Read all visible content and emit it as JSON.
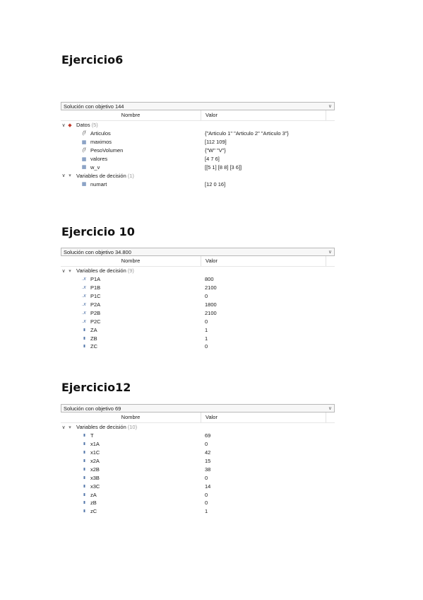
{
  "sections": [
    {
      "heading": "Ejercicio6",
      "dropdown": "Solución con objetivo 144",
      "col_name": "Nombre",
      "col_value": "Valor",
      "rows": [
        {
          "label": "Datos",
          "count": "(5)",
          "icon": "data-group-icon",
          "value": ""
        },
        {
          "label": "Articulos",
          "icon": "string-set-icon",
          "value": "{\"Articulo 1\" \"Articulo 2\" \"Articulo 3\"}"
        },
        {
          "label": "maximos",
          "icon": "array-icon",
          "value": "[112 109]"
        },
        {
          "label": "PesoVolumen",
          "icon": "string-set-icon",
          "value": "{\"W\" \"V\"}"
        },
        {
          "label": "valores",
          "icon": "array-icon",
          "value": "[4 7 6]"
        },
        {
          "label": "w_v",
          "icon": "array-icon",
          "value": "[[5 1]  [8 8]  [3 6]]"
        },
        {
          "label": "Variables de decisión",
          "count": "(1)",
          "icon": "decision-variables-icon",
          "value": ""
        },
        {
          "label": "numart",
          "icon": "array-icon",
          "value": "[12 0 16]"
        }
      ]
    },
    {
      "heading": "Ejercicio 10",
      "dropdown": "Solución con objetivo 34.800",
      "col_name": "Nombre",
      "col_value": "Valor",
      "rows": [
        {
          "label": "Variables de decisión",
          "count": "(9)",
          "icon": "decision-variables-icon",
          "value": ""
        },
        {
          "label": "P1A",
          "icon": "float-variable-icon",
          "value": "800"
        },
        {
          "label": "P1B",
          "icon": "float-variable-icon",
          "value": "2100"
        },
        {
          "label": "P1C",
          "icon": "float-variable-icon",
          "value": "0"
        },
        {
          "label": "P2A",
          "icon": "float-variable-icon",
          "value": "1800"
        },
        {
          "label": "P2B",
          "icon": "float-variable-icon",
          "value": "2100"
        },
        {
          "label": "P2C",
          "icon": "float-variable-icon",
          "value": "0"
        },
        {
          "label": "ZA",
          "icon": "int-variable-icon",
          "value": "1"
        },
        {
          "label": "ZB",
          "icon": "int-variable-icon",
          "value": "1"
        },
        {
          "label": "ZC",
          "icon": "int-variable-icon",
          "value": "0"
        }
      ]
    },
    {
      "heading": "Ejercicio12",
      "dropdown": "Solución con objetivo 69",
      "col_name": "Nombre",
      "col_value": "Valor",
      "rows": [
        {
          "label": "Variables de decisión",
          "count": "(10)",
          "icon": "decision-variables-icon",
          "value": ""
        },
        {
          "label": "T",
          "icon": "int-variable-icon",
          "value": "69"
        },
        {
          "label": "x1A",
          "icon": "int-variable-icon",
          "value": "0"
        },
        {
          "label": "x1C",
          "icon": "int-variable-icon",
          "value": "42"
        },
        {
          "label": "x2A",
          "icon": "int-variable-icon",
          "value": "15"
        },
        {
          "label": "x2B",
          "icon": "int-variable-icon",
          "value": "38"
        },
        {
          "label": "x3B",
          "icon": "int-variable-icon",
          "value": "0"
        },
        {
          "label": "x3C",
          "icon": "int-variable-icon",
          "value": "14"
        },
        {
          "label": "zA",
          "icon": "int-variable-icon",
          "value": "0"
        },
        {
          "label": "zB",
          "icon": "int-variable-icon",
          "value": "0"
        },
        {
          "label": "zC",
          "icon": "int-variable-icon",
          "value": "1"
        }
      ]
    }
  ]
}
